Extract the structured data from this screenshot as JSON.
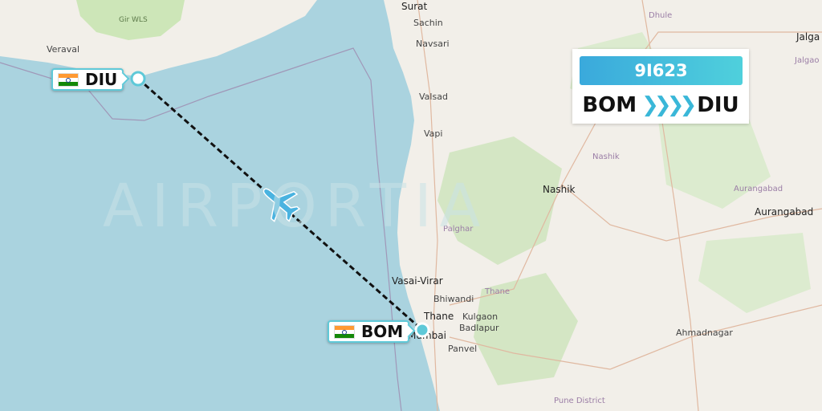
{
  "flight": {
    "number": "9I623",
    "origin": "BOM",
    "destination": "DIU",
    "route_arrow": "❯❯❯❯"
  },
  "watermark": "AIRPORTIA",
  "airports": [
    {
      "code": "DIU",
      "country_flag": "india-flag"
    },
    {
      "code": "BOM",
      "country_flag": "india-flag"
    }
  ],
  "map_labels": {
    "surat": "Surat",
    "sachin": "Sachin",
    "navsari": "Navsari",
    "valsad": "Valsad",
    "vapi": "Vapi",
    "dhule": "Dhule",
    "jalgaon": "Jalga",
    "jalgaon_region": "Jalgao",
    "nashik_region": "Nashik",
    "nashik": "Nashik",
    "aurangabad_region": "Aurangabad",
    "aurangabad": "Aurangabad",
    "palghar": "Palghar",
    "vasai": "Vasai-Virar",
    "bhiwandi": "Bhiwandi",
    "thane_region": "Thane",
    "thane": "Thane",
    "kulgaon": "Kulgaon",
    "badlapur": "Badlapur",
    "mumbai": "Mumbai",
    "panvel": "Panvel",
    "ahmadnagar": "Ahmadnagar",
    "pune": "Pune District",
    "veraval": "Veraval",
    "gir": "Gir WLS"
  },
  "colors": {
    "sea": "#aad3df",
    "land": "#f2efe9",
    "accent": "#5fc9d8",
    "route": "#111111"
  }
}
